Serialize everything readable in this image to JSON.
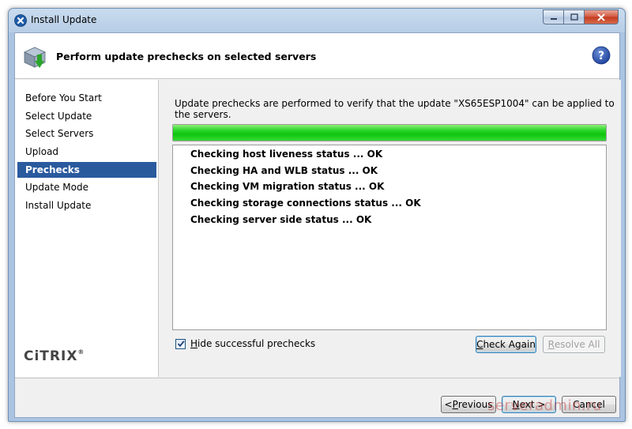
{
  "window": {
    "title": "Install Update"
  },
  "header": {
    "title": "Perform update prechecks on selected servers",
    "help_icon": "help-icon"
  },
  "sidebar": {
    "steps": [
      {
        "label": "Before You Start",
        "active": false
      },
      {
        "label": "Select Update",
        "active": false
      },
      {
        "label": "Select Servers",
        "active": false
      },
      {
        "label": "Upload",
        "active": false
      },
      {
        "label": "Prechecks",
        "active": true
      },
      {
        "label": "Update Mode",
        "active": false
      },
      {
        "label": "Install Update",
        "active": false
      }
    ],
    "logo": "CiTRIX"
  },
  "main": {
    "intro": "Update prechecks are performed to verify that the update \"XS65ESP1004\" can be applied to the servers.",
    "progress": 1.0,
    "results": [
      "Checking host liveness status ... OK",
      "Checking HA and WLB status ... OK",
      "Checking VM migration status ... OK",
      "Checking storage connections status ... OK",
      "Checking server side status ... OK"
    ],
    "hide_checkbox": {
      "label_accel": "H",
      "label_rest": "ide successful prechecks",
      "checked": true
    },
    "check_again": {
      "accel": "C",
      "rest": "heck Again"
    },
    "resolve_all": {
      "accel": "R",
      "rest": "esolve All"
    }
  },
  "footer": {
    "previous": {
      "prefix": "< ",
      "accel": "P",
      "rest": "revious"
    },
    "next": {
      "accel": "N",
      "rest": "ext >"
    },
    "cancel": "Cancel"
  },
  "watermark": "serveradmin.ru",
  "colors": {
    "selected_step": "#2a5a9e",
    "progress_green": "#0fc50f"
  }
}
